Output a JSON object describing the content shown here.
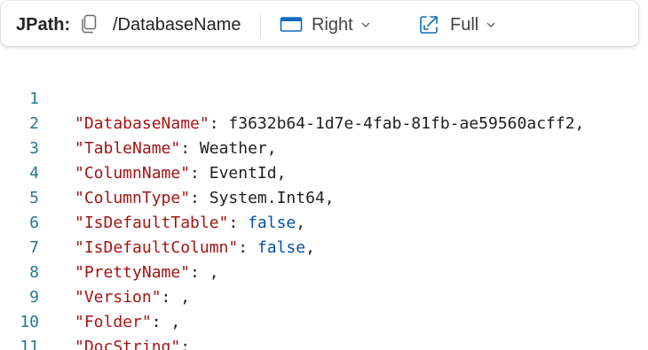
{
  "toolbar": {
    "jpath_label": "JPath:",
    "path": "/DatabaseName",
    "dock_label": "Right",
    "view_label": "Full",
    "icons": {
      "copy": "copy-icon",
      "dock": "panel-right-icon",
      "view": "expand-icon",
      "chevron": "chevron-down-icon"
    }
  },
  "colors": {
    "key": "#a31515",
    "keyword": "#0451a5",
    "line_number": "#237893",
    "text": "#1f1f1f"
  },
  "lines": [
    {
      "num": "1",
      "key": "\"DatabaseName\"",
      "sep": ": ",
      "value": "f3632b64-1d7e-4fab-81fb-ae59560acff2",
      "trail": ",",
      "kw": false
    },
    {
      "num": "2",
      "key": "\"TableName\"",
      "sep": ": ",
      "value": "Weather",
      "trail": ",",
      "kw": false
    },
    {
      "num": "3",
      "key": "\"ColumnName\"",
      "sep": ": ",
      "value": "EventId",
      "trail": ",",
      "kw": false
    },
    {
      "num": "4",
      "key": "\"ColumnType\"",
      "sep": ": ",
      "value": "System.Int64",
      "trail": ",",
      "kw": false
    },
    {
      "num": "5",
      "key": "\"IsDefaultTable\"",
      "sep": ": ",
      "value": "false",
      "trail": ",",
      "kw": true
    },
    {
      "num": "6",
      "key": "\"IsDefaultColumn\"",
      "sep": ": ",
      "value": "false",
      "trail": ",",
      "kw": true
    },
    {
      "num": "7",
      "key": "\"PrettyName\"",
      "sep": ": ",
      "value": "",
      "trail": ",",
      "kw": false
    },
    {
      "num": "8",
      "key": "\"Version\"",
      "sep": ": ",
      "value": "",
      "trail": ",",
      "kw": false
    },
    {
      "num": "9",
      "key": "\"Folder\"",
      "sep": ": ",
      "value": "",
      "trail": ",",
      "kw": false
    },
    {
      "num": "10",
      "key": "\"DocString\"",
      "sep": ":",
      "value": "",
      "trail": "",
      "kw": false
    },
    {
      "num": "11",
      "key": "",
      "sep": "",
      "value": "",
      "trail": "",
      "kw": false
    }
  ]
}
